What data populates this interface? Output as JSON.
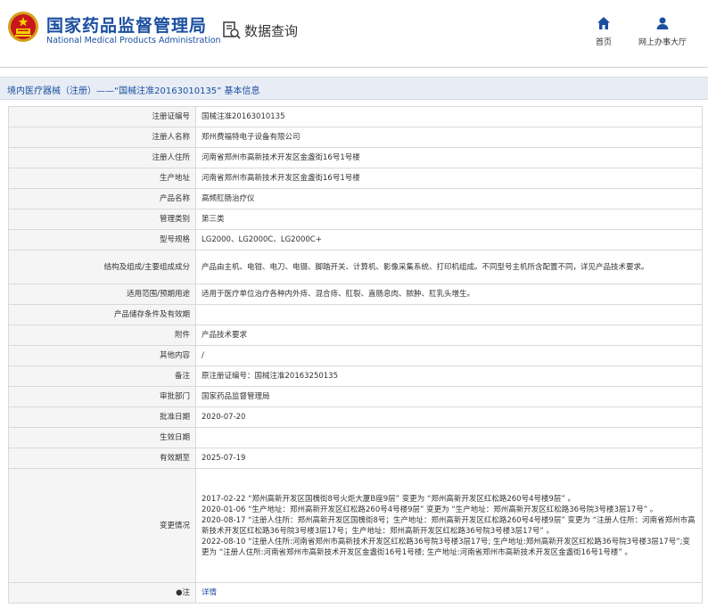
{
  "header": {
    "org_cn": "国家药品监督管理局",
    "org_en": "National Medical Products Administration",
    "query_label": "数据查询",
    "nav": [
      {
        "label": "首页",
        "icon": "home-icon"
      },
      {
        "label": "网上办事大厅",
        "icon": "person-icon"
      }
    ]
  },
  "breadcrumb": {
    "text": "境内医疗器械（注册）——“国械注准20163010135” 基本信息"
  },
  "colors": {
    "brand_blue": "#1a4fa0",
    "label_bg": "#f5f5f5",
    "crumb_bg": "#e8edf5"
  },
  "rows": [
    {
      "label": "注册证编号",
      "value": "国械注准20163010135"
    },
    {
      "label": "注册人名称",
      "value": "郑州费福特电子设备有限公司"
    },
    {
      "label": "注册人住所",
      "value": "河南省郑州市高新技术开发区金盏街16号1号楼"
    },
    {
      "label": "生产地址",
      "value": "河南省郑州市高新技术开发区金盏街16号1号楼"
    },
    {
      "label": "产品名称",
      "value": "高频肛肠治疗仪"
    },
    {
      "label": "管理类别",
      "value": "第三类"
    },
    {
      "label": "型号规格",
      "value": "LG2000、LG2000C、LG2000C+"
    },
    {
      "label": "结构及组成/主要组成成分",
      "value": "产品由主机、电钳、电刀、电镊、脚踏开关、计算机、影像采集系统、打印机组成。不同型号主机所含配置不同，详见产品技术要求。"
    },
    {
      "label": "适用范围/预期用途",
      "value": "适用于医疗单位治疗各种内外痔、混合痔、肛裂、直肠息肉、脓肿、肛乳头增生。"
    },
    {
      "label": "产品储存条件及有效期",
      "value": ""
    },
    {
      "label": "附件",
      "value": "产品技术要求"
    },
    {
      "label": "其他内容",
      "value": "/"
    },
    {
      "label": "备注",
      "value": "原注册证编号：国械注准20163250135"
    },
    {
      "label": "审批部门",
      "value": "国家药品监督管理局"
    },
    {
      "label": "批准日期",
      "value": "2020-07-20"
    },
    {
      "label": "生效日期",
      "value": ""
    },
    {
      "label": "有效期至",
      "value": "2025-07-19"
    }
  ],
  "changes": {
    "label": "变更情况",
    "lines": [
      "2017-02-22 “郑州高新开发区国槐街8号火炬大厦B座9层” 变更为 “郑州高新开发区红松路260号4号楼9层” 。",
      "2020-01-06 “生产地址：郑州高新开发区红松路260号4号楼9层” 变更为 “生产地址：郑州高新开发区红松路36号院3号楼3层17号” 。",
      "2020-08-17 “注册人住所：郑州高新开发区国槐街8号；生产地址：郑州高新开发区红松路260号4号楼9层” 变更为 “注册人住所：河南省郑州市高新技术开发区红松路36号院3号楼3层17号；生产地址：郑州高新开发区红松路36号院3号楼3层17号” 。",
      "2022-08-10 “注册人住所:河南省郑州市高新技术开发区红松路36号院3号楼3层17号; 生产地址:郑州高新开发区红松路36号院3号楼3层17号”;变更为 “注册人住所:河南省郑州市高新技术开发区金盏街16号1号楼; 生产地址:河南省郑州市高新技术开发区金盏街16号1号楼” 。"
    ]
  },
  "note": {
    "label": "●注",
    "link": "详情"
  }
}
